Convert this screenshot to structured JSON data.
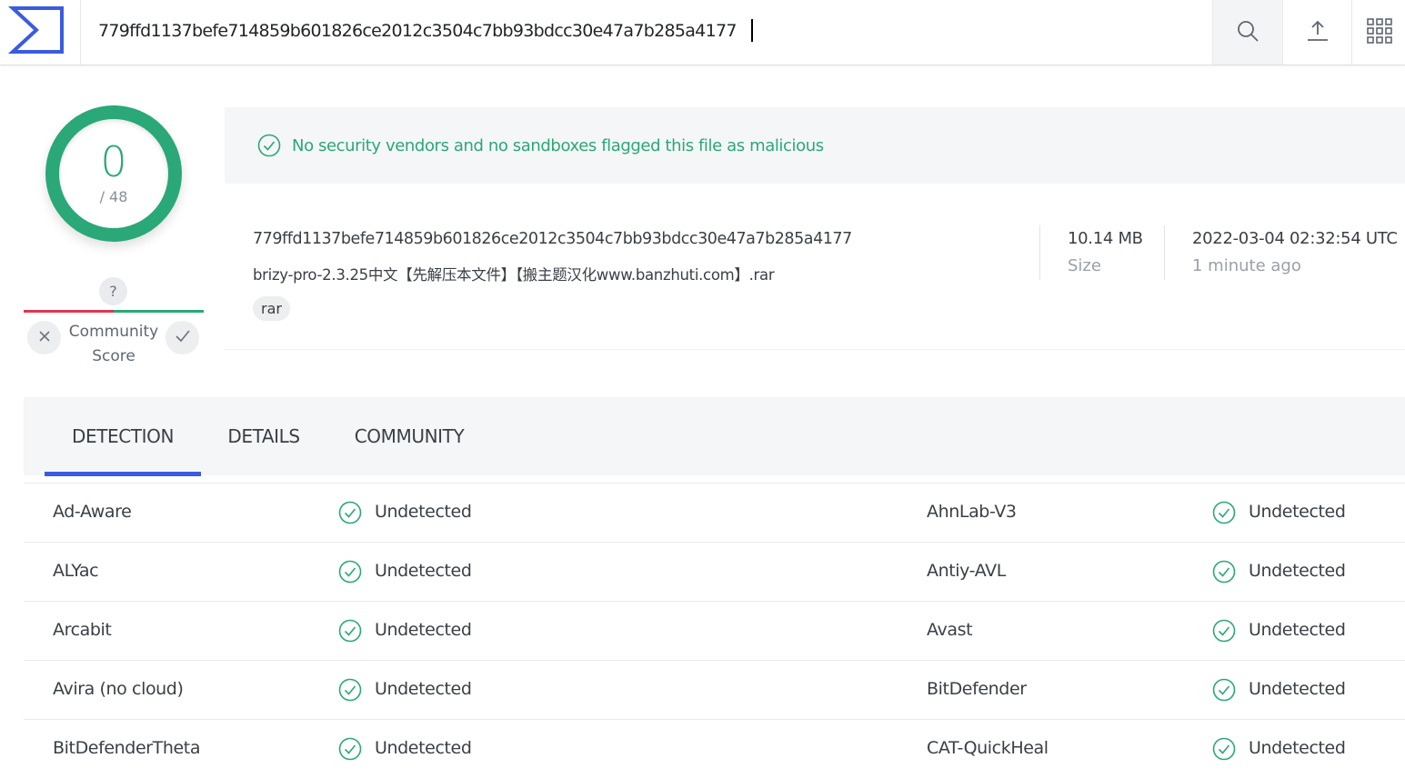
{
  "search": {
    "value": "779ffd1137befe714859b601826ce2012c3504c7bb93bdcc30e47a7b285a4177"
  },
  "header_icons": {
    "logo": "sigma-logo-icon",
    "search": "search-icon",
    "upload": "upload-icon",
    "apps": "apps-grid-icon"
  },
  "colors": {
    "accent": "#3b5be0",
    "clean": "#2aa877",
    "malicious": "#e0364f"
  },
  "score": {
    "detections": "0",
    "total": "/ 48"
  },
  "community": {
    "question": "?",
    "label_line1": "Community",
    "label_line2": "Score"
  },
  "banner": {
    "text": "No security vendors and no sandboxes flagged this file as malicious"
  },
  "file": {
    "hash": "779ffd1137befe714859b601826ce2012c3504c7bb93bdcc30e47a7b285a4177",
    "name": "brizy-pro-2.3.25中文【先解压本文件】【搬主题汉化www.banzhuti.com】.rar",
    "tag": "rar",
    "size_value": "10.14 MB",
    "size_label": "Size",
    "date_value": "2022-03-04 02:32:54 UTC",
    "date_label": "1 minute ago"
  },
  "tabs": [
    {
      "label": "DETECTION",
      "active": true
    },
    {
      "label": "DETAILS",
      "active": false
    },
    {
      "label": "COMMUNITY",
      "active": false
    }
  ],
  "detections": [
    {
      "left_vendor": "Ad-Aware",
      "left_status": "Undetected",
      "right_vendor": "AhnLab-V3",
      "right_status": "Undetected"
    },
    {
      "left_vendor": "ALYac",
      "left_status": "Undetected",
      "right_vendor": "Antiy-AVL",
      "right_status": "Undetected"
    },
    {
      "left_vendor": "Arcabit",
      "left_status": "Undetected",
      "right_vendor": "Avast",
      "right_status": "Undetected"
    },
    {
      "left_vendor": "Avira (no cloud)",
      "left_status": "Undetected",
      "right_vendor": "BitDefender",
      "right_status": "Undetected"
    },
    {
      "left_vendor": "BitDefenderTheta",
      "left_status": "Undetected",
      "right_vendor": "CAT-QuickHeal",
      "right_status": "Undetected"
    }
  ]
}
